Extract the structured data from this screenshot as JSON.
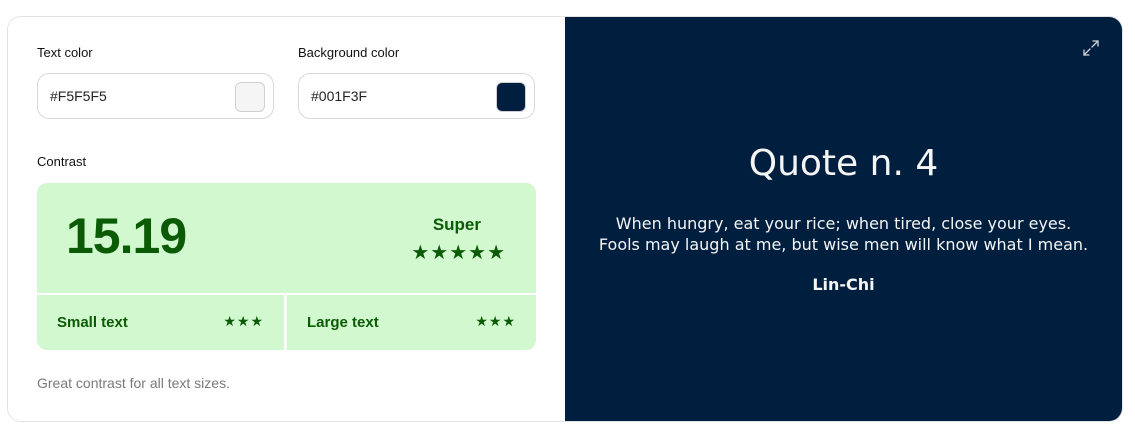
{
  "text_color": {
    "label": "Text color",
    "value": "#F5F5F5"
  },
  "background_color": {
    "label": "Background color",
    "value": "#001F3F"
  },
  "contrast": {
    "label": "Contrast",
    "ratio": "15.19",
    "rating": "Super",
    "rating_stars": "★★★★★",
    "small_text": {
      "label": "Small text",
      "stars": "★★★"
    },
    "large_text": {
      "label": "Large text",
      "stars": "★★★"
    },
    "verdict": "Great contrast for all text sizes."
  },
  "colors": {
    "success_bg": "#d1f8ce",
    "success_fg": "#0b5a05"
  },
  "preview": {
    "expand_icon": "expand-icon",
    "title": "Quote n. 4",
    "quote_line_1": "When hungry, eat your rice; when tired, close your eyes.",
    "quote_line_2": "Fools may laugh at me, but wise men will know what I mean.",
    "author": "Lin-Chi"
  }
}
